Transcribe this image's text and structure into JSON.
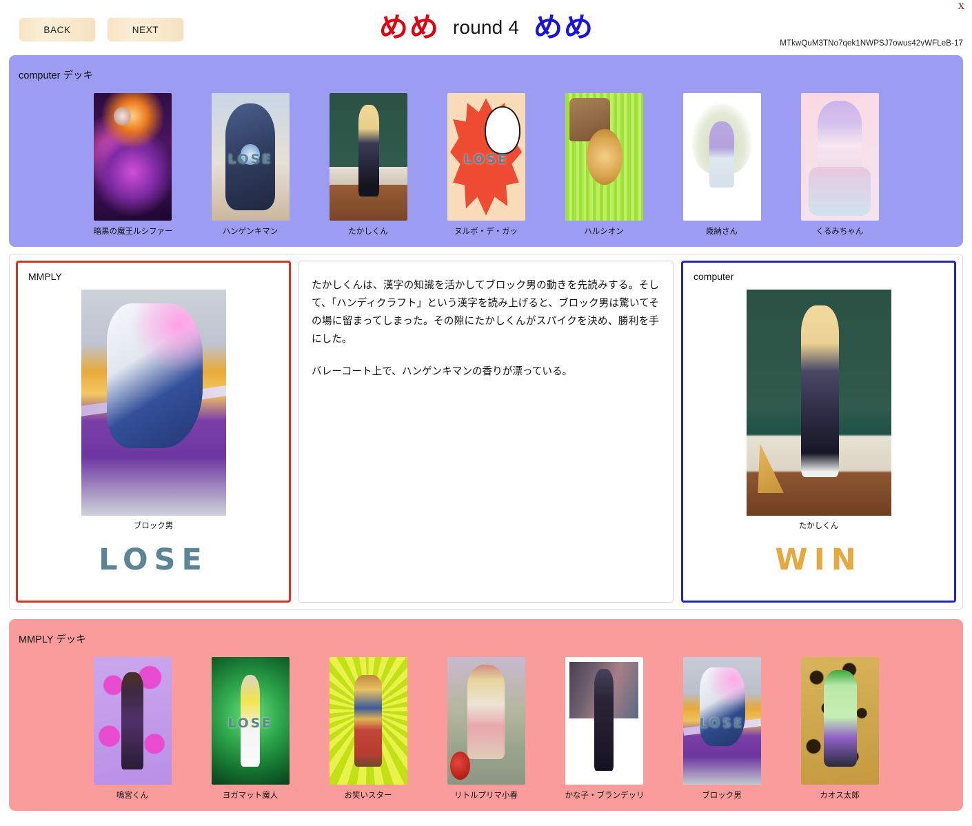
{
  "header": {
    "close_label": "X",
    "back_label": "BACK",
    "next_label": "NEXT",
    "round_label": "round 4",
    "pip_red_count": 2,
    "pip_blue_count": 2,
    "pip_glyph": "め",
    "pip_red_color": "#e00010",
    "pip_blue_color": "#1a13e0",
    "session_id": "MTkwQuM3TNo7qek1NWPSJ7owus42vWFLeB-17"
  },
  "computer_deck": {
    "title": "computer デッキ",
    "bg_color": "#9c9cf2",
    "cards": [
      {
        "name": "暗黒の魔王ルシファー",
        "art": "a-lucifer",
        "lose_overlay": false
      },
      {
        "name": "ハンゲンキマン",
        "art": "a-hangen",
        "lose_overlay": true,
        "overlay_text": "LOSE"
      },
      {
        "name": "たかしくん",
        "art": "a-takashi",
        "lose_overlay": false
      },
      {
        "name": "ヌルポ・デ・ガッ",
        "art": "a-nurupo",
        "lose_overlay": true,
        "overlay_text": "LOSE"
      },
      {
        "name": "ハルシオン",
        "art": "a-halcyon",
        "lose_overlay": false
      },
      {
        "name": "歳納さん",
        "art": "a-saino",
        "lose_overlay": false
      },
      {
        "name": "くるみちゃん",
        "art": "a-kurumi",
        "lose_overlay": false
      }
    ]
  },
  "player_deck": {
    "title": "MMPLY デッキ",
    "bg_color": "#fa9c9c",
    "cards": [
      {
        "name": "鳴宮くん",
        "art": "a-narumiya",
        "lose_overlay": false
      },
      {
        "name": "ヨガマット魔人",
        "art": "a-yoga",
        "lose_overlay": true,
        "overlay_text": "LOSE"
      },
      {
        "name": "お笑いスター",
        "art": "a-owarai",
        "lose_overlay": false
      },
      {
        "name": "リトルプリマ小春",
        "art": "a-koharu",
        "lose_overlay": false
      },
      {
        "name": "かな子・ブランデッリ",
        "art": "a-kanako",
        "lose_overlay": false
      },
      {
        "name": "ブロック男",
        "art": "a-block",
        "lose_overlay": true,
        "overlay_text": "LOSE"
      },
      {
        "name": "カオス太郎",
        "art": "a-chaos",
        "lose_overlay": false
      }
    ]
  },
  "battle": {
    "left": {
      "side_label": "MMPLY",
      "card_name": "ブロック男",
      "card_art": "a-block-big",
      "outcome": "LOSE",
      "outcome_color": "#5b8494",
      "border_color": "#e03023"
    },
    "right": {
      "side_label": "computer",
      "card_name": "たかしくん",
      "card_art": "a-takashi-big",
      "outcome": "WIN",
      "outcome_color": "#e5a93f",
      "border_color": "#2424c8"
    },
    "narration": [
      "たかしくんは、漢字の知識を活かしてブロック男の動きを先読みする。そして、「ハンディクラフト」という漢字を読み上げると、ブロック男は驚いてその場に留まってしまった。その隙にたかしくんがスパイクを決め、勝利を手にした。",
      "バレーコート上で、ハンゲンキマンの香りが漂っている。"
    ]
  }
}
